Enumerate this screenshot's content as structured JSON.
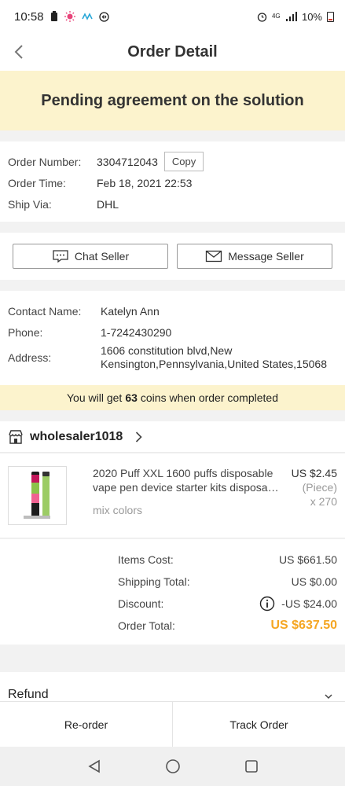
{
  "status_bar": {
    "time": "10:58",
    "battery": "10%",
    "network": "4G"
  },
  "header": {
    "title": "Order Detail"
  },
  "banner": {
    "text": "Pending agreement on the solution"
  },
  "order": {
    "number_label": "Order Number:",
    "number": "3304712043",
    "copy_label": "Copy",
    "time_label": "Order Time:",
    "time": "Feb 18, 2021 22:53",
    "ship_label": "Ship Via:",
    "ship": "DHL"
  },
  "actions": {
    "chat": "Chat Seller",
    "message": "Message Seller"
  },
  "contact": {
    "name_label": "Contact Name:",
    "name": "Katelyn Ann",
    "phone_label": "Phone:",
    "phone": "1-7242430290",
    "address_label": "Address:",
    "address": "1606 constitution blvd,New Kensington,Pennsylvania,United States,15068"
  },
  "coins": {
    "prefix": "You will get",
    "amount": "63",
    "suffix": "coins when order completed"
  },
  "shop": {
    "name": "wholesaler1018"
  },
  "product": {
    "title": "2020 Puff XXL 1600 puffs disposable vape pen device starter kits disposa…",
    "variant": "mix colors",
    "price": "US $2.45",
    "unit": "(Piece)",
    "qty": "x 270"
  },
  "costs": {
    "items_label": "Items Cost:",
    "items": "US $661.50",
    "shipping_label": "Shipping Total:",
    "shipping": "US $0.00",
    "discount_label": "Discount:",
    "discount": "-US $24.00",
    "total_label": "Order Total:",
    "total": "US $637.50"
  },
  "refund": {
    "label": "Refund"
  },
  "bottom": {
    "reorder": "Re-order",
    "track": "Track Order"
  },
  "colors": {
    "banner_bg": "#fcf3cd",
    "accent_total": "#f5a623"
  }
}
